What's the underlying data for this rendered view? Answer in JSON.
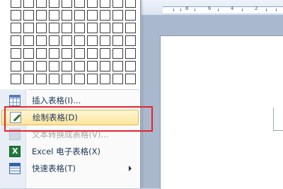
{
  "ruler": {
    "ticks": [
      "8",
      "6",
      "4",
      "2"
    ]
  },
  "menu": {
    "grid": {
      "columns": 10,
      "rows": 7
    },
    "items": [
      {
        "label": "插入表格(I)...",
        "icon": "insert-table-icon",
        "disabled": false
      },
      {
        "label": "绘制表格(D)",
        "icon": "draw-table-icon",
        "disabled": false,
        "highlighted": true
      },
      {
        "label": "文本转换成表格(V)...",
        "icon": "convert-text-icon",
        "disabled": true
      },
      {
        "label": "Excel 电子表格(X)",
        "icon": "excel-icon",
        "disabled": false
      },
      {
        "label": "快速表格(T)",
        "icon": "quick-table-icon",
        "disabled": false,
        "submenu": true
      }
    ]
  },
  "colors": {
    "highlight_border": "#e8232c",
    "hover_bg": "#ffe59a"
  }
}
